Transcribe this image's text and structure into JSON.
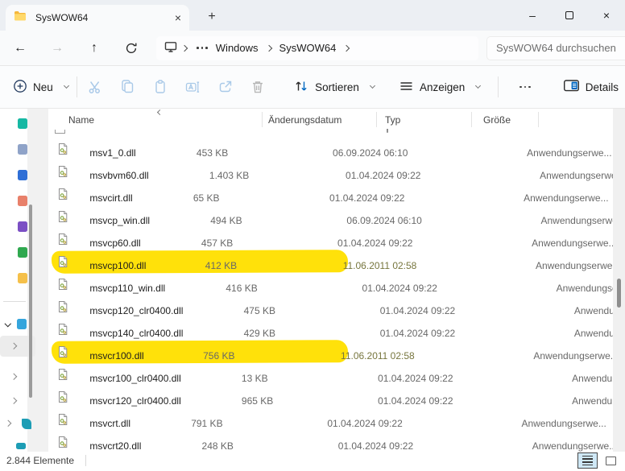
{
  "tab_bar": {
    "active_tab": {
      "label": "SysWOW64"
    },
    "close_glyph": "×",
    "new_tab_glyph": "+"
  },
  "window_controls": {
    "minimize": "–",
    "close": "×"
  },
  "nav": {
    "breadcrumb": {
      "root_icon": "this-pc-monitor-icon",
      "overflow_icon": "more-ellipsis",
      "items": [
        "Windows",
        "SysWOW64"
      ]
    },
    "search": {
      "placeholder": "SysWOW64 durchsuchen"
    }
  },
  "toolbar": {
    "new_button": "Neu",
    "icon_buttons": [
      "cut",
      "copy",
      "paste",
      "rename",
      "share",
      "delete"
    ],
    "sort_button": "Sortieren",
    "view_button": "Anzeigen",
    "more_button": "see-more-ellipsis",
    "details_button": "Details"
  },
  "file_list": {
    "columns": [
      "Name",
      "Änderungsdatum",
      "Typ",
      "Größe"
    ],
    "sort_column": "Name",
    "sort_direction": "ascending",
    "rows": [
      {
        "name": "msv1_0.dll",
        "date": "06.09.2024 06:10",
        "type": "Anwendungserwe...",
        "size": "453 KB",
        "highlighted": false
      },
      {
        "name": "msvbvm60.dll",
        "date": "01.04.2024 09:22",
        "type": "Anwendungserwe...",
        "size": "1.403 KB",
        "highlighted": false
      },
      {
        "name": "msvcirt.dll",
        "date": "01.04.2024 09:22",
        "type": "Anwendungserwe...",
        "size": "65 KB",
        "highlighted": false
      },
      {
        "name": "msvcp_win.dll",
        "date": "06.09.2024 06:10",
        "type": "Anwendungserwe...",
        "size": "494 KB",
        "highlighted": false
      },
      {
        "name": "msvcp60.dll",
        "date": "01.04.2024 09:22",
        "type": "Anwendungserwe...",
        "size": "457 KB",
        "highlighted": false
      },
      {
        "name": "msvcp100.dll",
        "date": "11.06.2011 02:58",
        "type": "Anwendungserwe...",
        "size": "412 KB",
        "highlighted": true
      },
      {
        "name": "msvcp110_win.dll",
        "date": "01.04.2024 09:22",
        "type": "Anwendungserwe...",
        "size": "416 KB",
        "highlighted": false
      },
      {
        "name": "msvcp120_clr0400.dll",
        "date": "01.04.2024 09:22",
        "type": "Anwendungserwe...",
        "size": "475 KB",
        "highlighted": false
      },
      {
        "name": "msvcp140_clr0400.dll",
        "date": "01.04.2024 09:22",
        "type": "Anwendungserwe...",
        "size": "429 KB",
        "highlighted": false
      },
      {
        "name": "msvcr100.dll",
        "date": "11.06.2011 02:58",
        "type": "Anwendungserwe...",
        "size": "756 KB",
        "highlighted": true
      },
      {
        "name": "msvcr100_clr0400.dll",
        "date": "01.04.2024 09:22",
        "type": "Anwendungserwe...",
        "size": "13 KB",
        "highlighted": false
      },
      {
        "name": "msvcr120_clr0400.dll",
        "date": "01.04.2024 09:22",
        "type": "Anwendungserwe...",
        "size": "965 KB",
        "highlighted": false
      },
      {
        "name": "msvcrt.dll",
        "date": "01.04.2024 09:22",
        "type": "Anwendungserwe...",
        "size": "791 KB",
        "highlighted": false
      },
      {
        "name": "msvcrt20.dll",
        "date": "01.04.2024 09:22",
        "type": "Anwendungserwe...",
        "size": "248 KB",
        "highlighted": false
      }
    ]
  },
  "status_bar": {
    "item_count": "2.844 Elemente",
    "view_toggles": [
      "details-view",
      "large-icons-view"
    ]
  },
  "sidebar": {
    "partial_icon_colors": [
      "#16b8a3",
      "#8fa3c8",
      "#2f6fd6",
      "#e8806a",
      "#7b4fc4",
      "#2fa84f",
      "#f5c04a"
    ],
    "this_pc_icon_color": "#35a5dc",
    "network_icon_color": "#1d9db5"
  },
  "colors": {
    "marker_highlight": "#ffe10a",
    "accent_blue": "#0067c0",
    "disabled_icon_blue": "#a9c9e8",
    "disabled_icon_gray": "#b7b7b7"
  }
}
